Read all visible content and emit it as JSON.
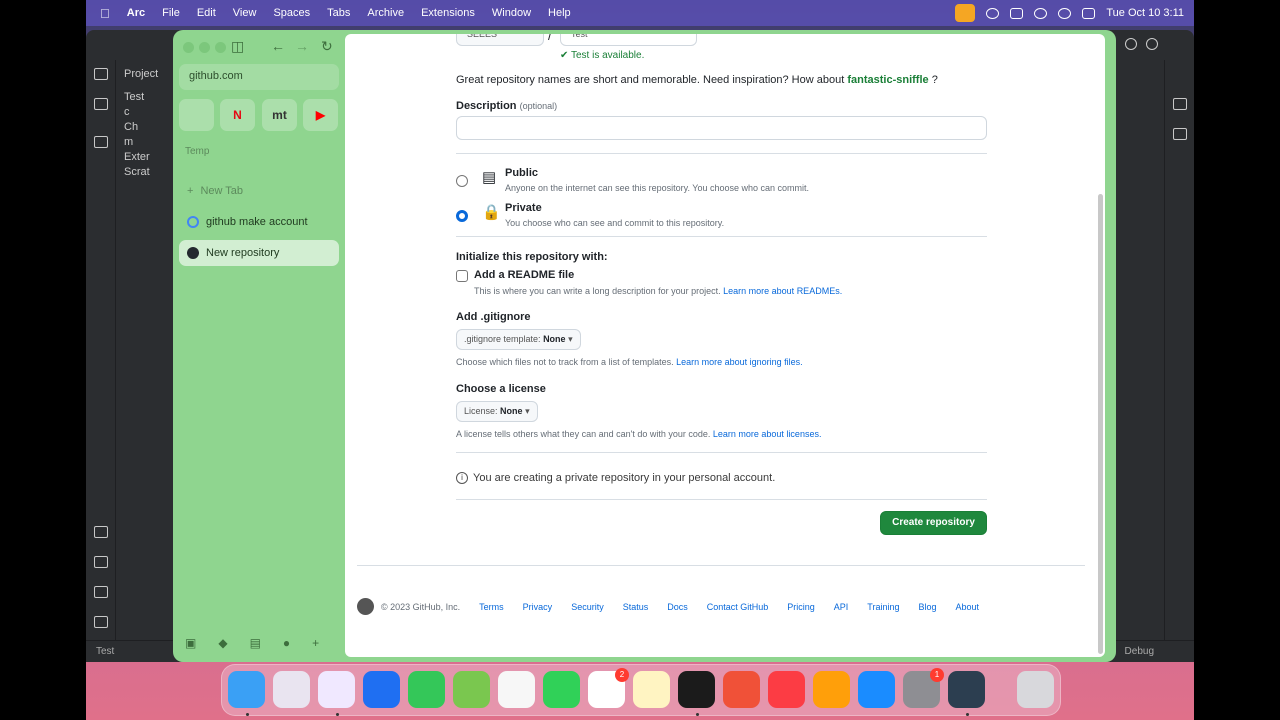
{
  "menubar": {
    "app": "Arc",
    "items": [
      "File",
      "Edit",
      "View",
      "Spaces",
      "Tabs",
      "Archive",
      "Extensions",
      "Window",
      "Help"
    ],
    "datetime": "Tue Oct 10  3:11"
  },
  "ide": {
    "project_label": "Project",
    "tree": [
      "Test",
      "c",
      "Ch",
      "m",
      "Exter",
      "Scrat"
    ],
    "status_left": "Test",
    "status_right": "Debug"
  },
  "sidebar": {
    "url": "github.com",
    "favorites": [
      "",
      "N",
      "mt",
      "▶"
    ],
    "section": "Temp",
    "new_tab": "New Tab",
    "tabs": [
      "github make account",
      "New repository"
    ]
  },
  "page": {
    "owner": "SEEES",
    "repo_name": "Test",
    "available": "Test is available.",
    "hint_prefix": "Great repository names are short and memorable. Need inspiration? How about",
    "hint_suggestion": "fantastic-sniffle",
    "hint_suffix": "?",
    "description_label": "Description",
    "description_optional": "(optional)",
    "public_title": "Public",
    "public_desc": "Anyone on the internet can see this repository. You choose who can commit.",
    "private_title": "Private",
    "private_desc": "You choose who can see and commit to this repository.",
    "init_label": "Initialize this repository with:",
    "readme_title": "Add a README file",
    "readme_desc": "This is where you can write a long description for your project.",
    "readme_link": "Learn more about READMEs.",
    "gitignore_label": "Add .gitignore",
    "gitignore_dropdown_prefix": ".gitignore template:",
    "gitignore_dropdown_value": "None",
    "gitignore_desc": "Choose which files not to track from a list of templates.",
    "gitignore_link": "Learn more about ignoring files.",
    "license_label": "Choose a license",
    "license_dropdown_prefix": "License:",
    "license_dropdown_value": "None",
    "license_desc": "A license tells others what they can and can't do with your code.",
    "license_link": "Learn more about licenses.",
    "info_text": "You are creating a private repository in your personal account.",
    "create_button": "Create repository",
    "footer_copyright": "© 2023 GitHub, Inc.",
    "footer_links": [
      "Terms",
      "Privacy",
      "Security",
      "Status",
      "Docs",
      "Contact GitHub",
      "Pricing",
      "API",
      "Training",
      "Blog",
      "About"
    ]
  },
  "dock": {
    "badges": {
      "reminders": "2",
      "settings": "1"
    }
  },
  "colors": {
    "arc_green": "#8fd58f",
    "github_green": "#1f883d",
    "link_blue": "#0969da"
  }
}
